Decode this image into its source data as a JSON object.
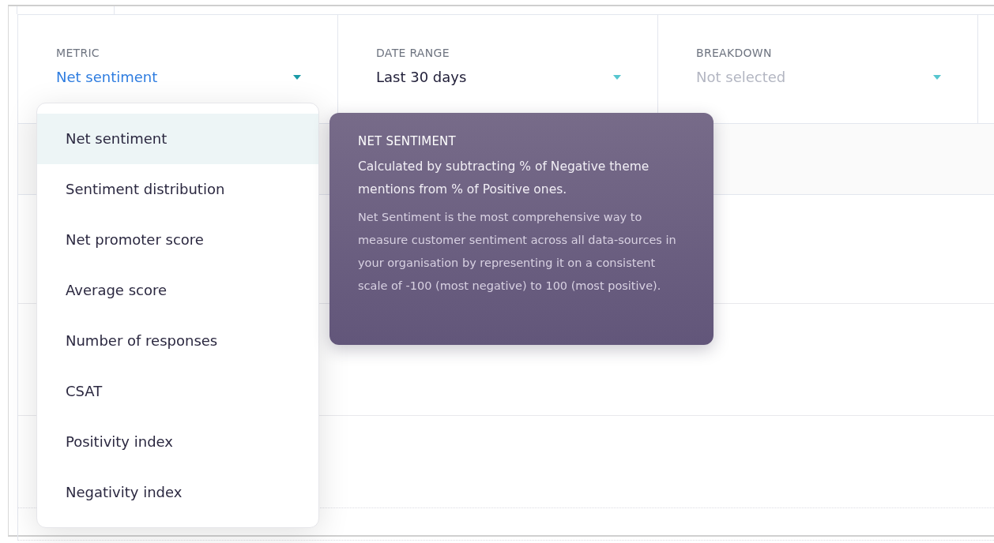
{
  "filters": [
    {
      "label": "METRIC",
      "value": "Net sentiment",
      "open": true
    },
    {
      "label": "DATE RANGE",
      "value": "Last 30 days",
      "open": false
    },
    {
      "label": "BREAKDOWN",
      "placeholder": "Not selected",
      "open": false
    }
  ],
  "metric_menu": {
    "items": [
      {
        "label": "Net sentiment",
        "selected": true
      },
      {
        "label": "Sentiment distribution",
        "selected": false
      },
      {
        "label": "Net promoter score",
        "selected": false
      },
      {
        "label": "Average score",
        "selected": false
      },
      {
        "label": "Number of responses",
        "selected": false
      },
      {
        "label": "CSAT",
        "selected": false
      },
      {
        "label": "Positivity index",
        "selected": false
      },
      {
        "label": "Negativity index",
        "selected": false
      }
    ]
  },
  "tooltip": {
    "title": "NET SENTIMENT",
    "summary": "Calculated by subtracting % of Negative theme mentions from % of Positive ones.",
    "detail": "Net Sentiment is the most comprehensive way to measure customer sentiment across all data-sources in your organisation by representing it on a consistent scale of -100 (most negative) to 100 (most positive)."
  }
}
